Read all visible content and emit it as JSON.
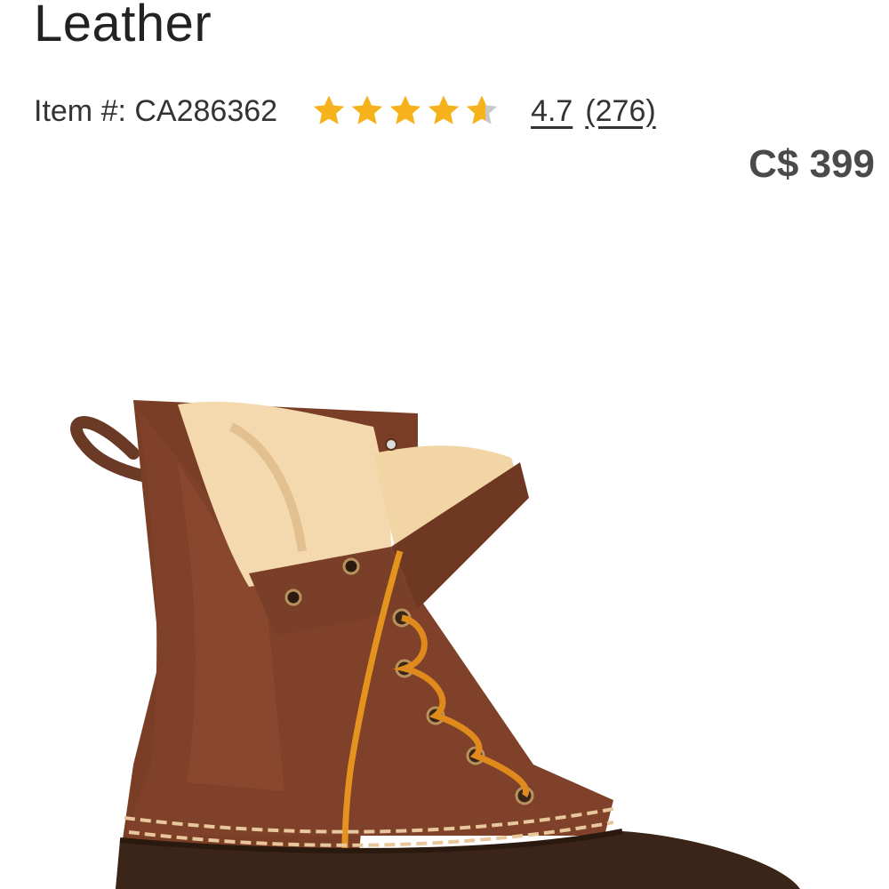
{
  "product": {
    "title": "Leather",
    "item_number": "Item #: CA286362",
    "rating": "4.7",
    "rating_fraction": 0.94,
    "review_count": "(276)",
    "price": "C$ 399"
  },
  "image": {
    "name": "leather-boot-photo"
  },
  "colors": {
    "star_fill": "#F5B21B",
    "star_empty": "#C8C8C8",
    "price_text": "#4A4A4A"
  }
}
